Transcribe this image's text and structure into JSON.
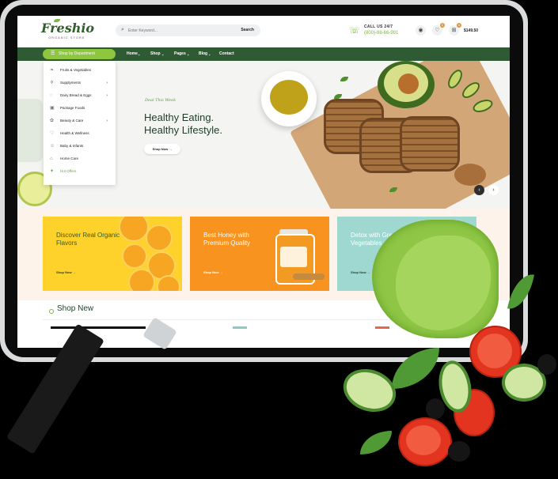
{
  "header": {
    "logo": "Freshio",
    "logo_sub": "ORGANIC STORE",
    "search_placeholder": "Enter Keyword...",
    "search_button": "Search",
    "call_label": "CALL US 24/7",
    "call_number": "(800)-88-66-991",
    "wishlist_count": "0",
    "cart_count": "0",
    "cart_total": "$149.50"
  },
  "nav": {
    "dept_label": "Shop by Department",
    "links": [
      "Home",
      "Shop",
      "Pages",
      "Blog",
      "Contact"
    ]
  },
  "departments": [
    {
      "label": "Fruits & Vegetables",
      "icon": "fruit-icon"
    },
    {
      "label": "Supplyments",
      "icon": "bottle-icon",
      "submenu": true
    },
    {
      "label": "Dairy Bread & Eggs",
      "icon": "egg-icon",
      "submenu": true
    },
    {
      "label": "Package Foods",
      "icon": "package-icon"
    },
    {
      "label": "Beauty & Care",
      "icon": "beauty-icon",
      "submenu": true
    },
    {
      "label": "Health & Wellness",
      "icon": "heart-icon"
    },
    {
      "label": "Baby & Infants",
      "icon": "baby-icon"
    },
    {
      "label": "Home Care",
      "icon": "home-icon"
    },
    {
      "label": "Hot Offers",
      "icon": "fire-icon",
      "highlight": true
    }
  ],
  "hero": {
    "tag": "Deal This Week",
    "title_line1": "Healthy Eating.",
    "title_line2": "Healthy Lifestyle.",
    "button": "Shop Now"
  },
  "banners": [
    {
      "title": "Discover Real Organic Flavors",
      "button": "Shop Now",
      "bg": "#ffd12b"
    },
    {
      "title": "Best Honey with Premium Quality",
      "button": "Shop Now",
      "bg": "#f7931e"
    },
    {
      "title": "Detox with Green Vegetables and Fruits",
      "button": "Shop Now",
      "bg": "#9fd8d1"
    }
  ],
  "section": {
    "title": "Shop New"
  },
  "colors": {
    "brand_green": "#2e5b33",
    "accent_green": "#8ec63f"
  }
}
